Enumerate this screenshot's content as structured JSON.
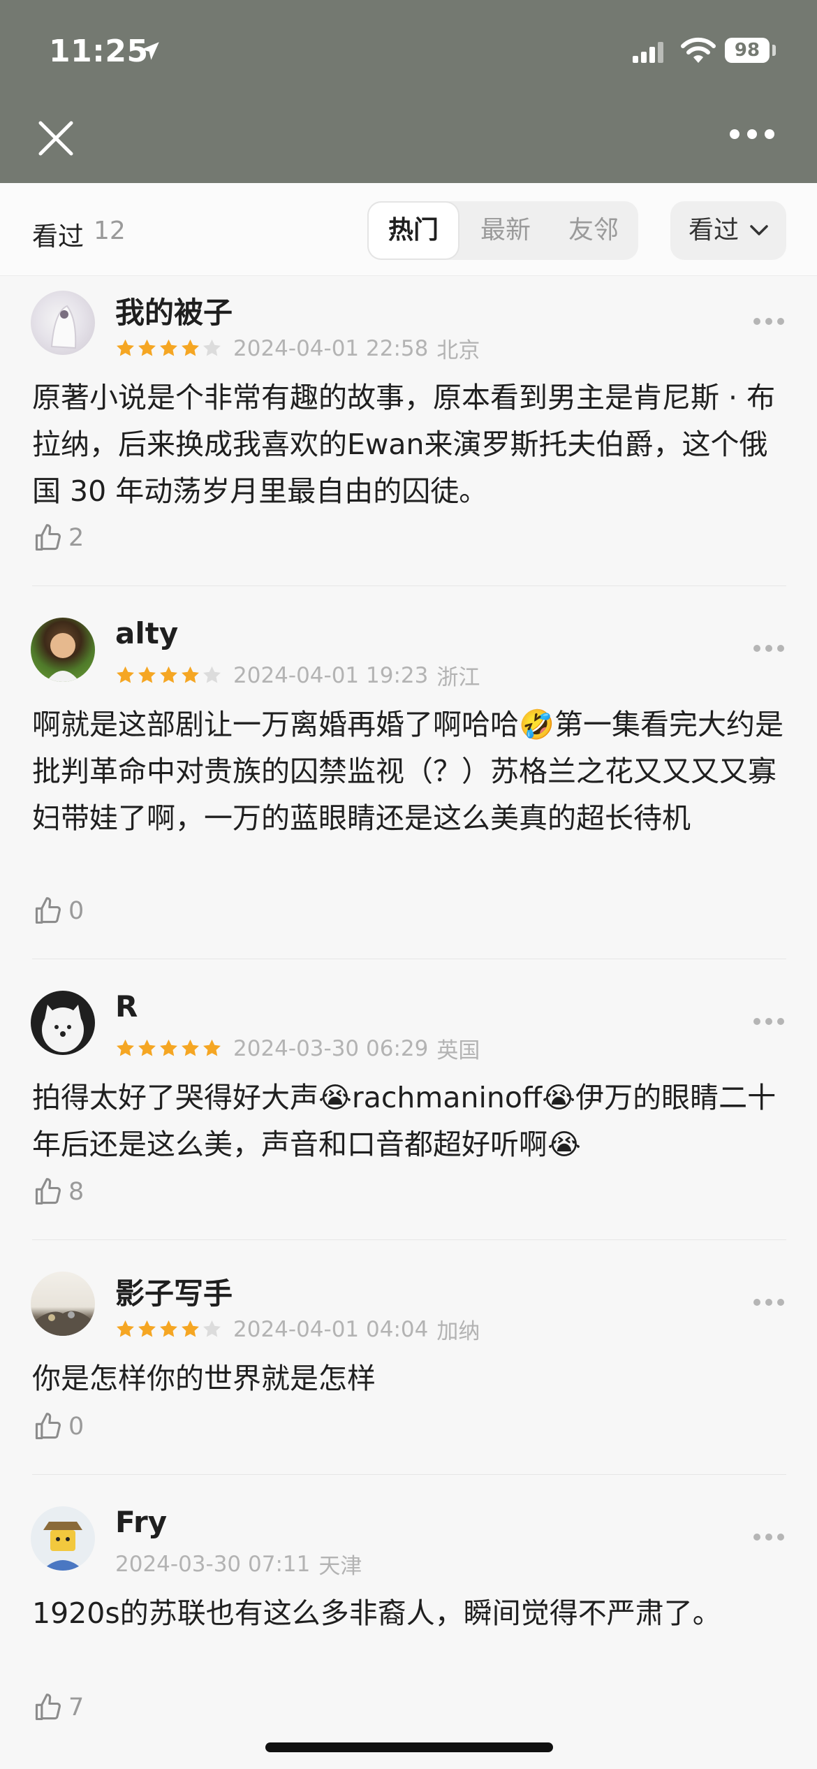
{
  "status": {
    "time": "11:25",
    "battery": "98"
  },
  "header": {
    "close_icon": "close-icon",
    "more_icon": "more-dots-icon"
  },
  "filter": {
    "title": "看过",
    "count": "12",
    "tabs": [
      {
        "label": "热门",
        "active": true
      },
      {
        "label": "最新",
        "active": false
      },
      {
        "label": "友邻",
        "active": false
      }
    ],
    "dropdown_label": "看过"
  },
  "colors": {
    "header_bg": "#747971",
    "star": "#f5a623",
    "star_empty": "#dcdcdc"
  },
  "comments": [
    {
      "user": "我的被子",
      "rating": 4,
      "time": "2024-04-01 22:58",
      "location": "北京",
      "text": "原著小说是个非常有趣的故事，原本看到男主是肯尼斯 · 布拉纳，后来换成我喜欢的Ewan来演罗斯托夫伯爵，这个俄国 30 年动荡岁月里最自由的囚徒。",
      "likes": "2"
    },
    {
      "user": "alty",
      "rating": 4,
      "time": "2024-04-01 19:23",
      "location": "浙江",
      "text": "啊就是这部剧让一万离婚再婚了啊哈哈🤣第一集看完大约是批判革命中对贵族的囚禁监视（？）苏格兰之花又又又又寡妇带娃了啊，一万的蓝眼睛还是这么美真的超长待机",
      "likes": "0"
    },
    {
      "user": "R",
      "rating": 5,
      "time": "2024-03-30 06:29",
      "location": "英国",
      "text": "拍得太好了哭得好大声😭rachmaninoff😭伊万的眼睛二十年后还是这么美，声音和口音都超好听啊😭",
      "likes": "8"
    },
    {
      "user": "影子写手",
      "rating": 4,
      "time": "2024-04-01 04:04",
      "location": "加纳",
      "text": "你是怎样你的世界就是怎样",
      "likes": "0"
    },
    {
      "user": "Fry",
      "rating": 0,
      "time": "2024-03-30 07:11",
      "location": "天津",
      "text": "1920s的苏联也有这么多非裔人，瞬间觉得不严肃了。",
      "likes": "7"
    }
  ]
}
